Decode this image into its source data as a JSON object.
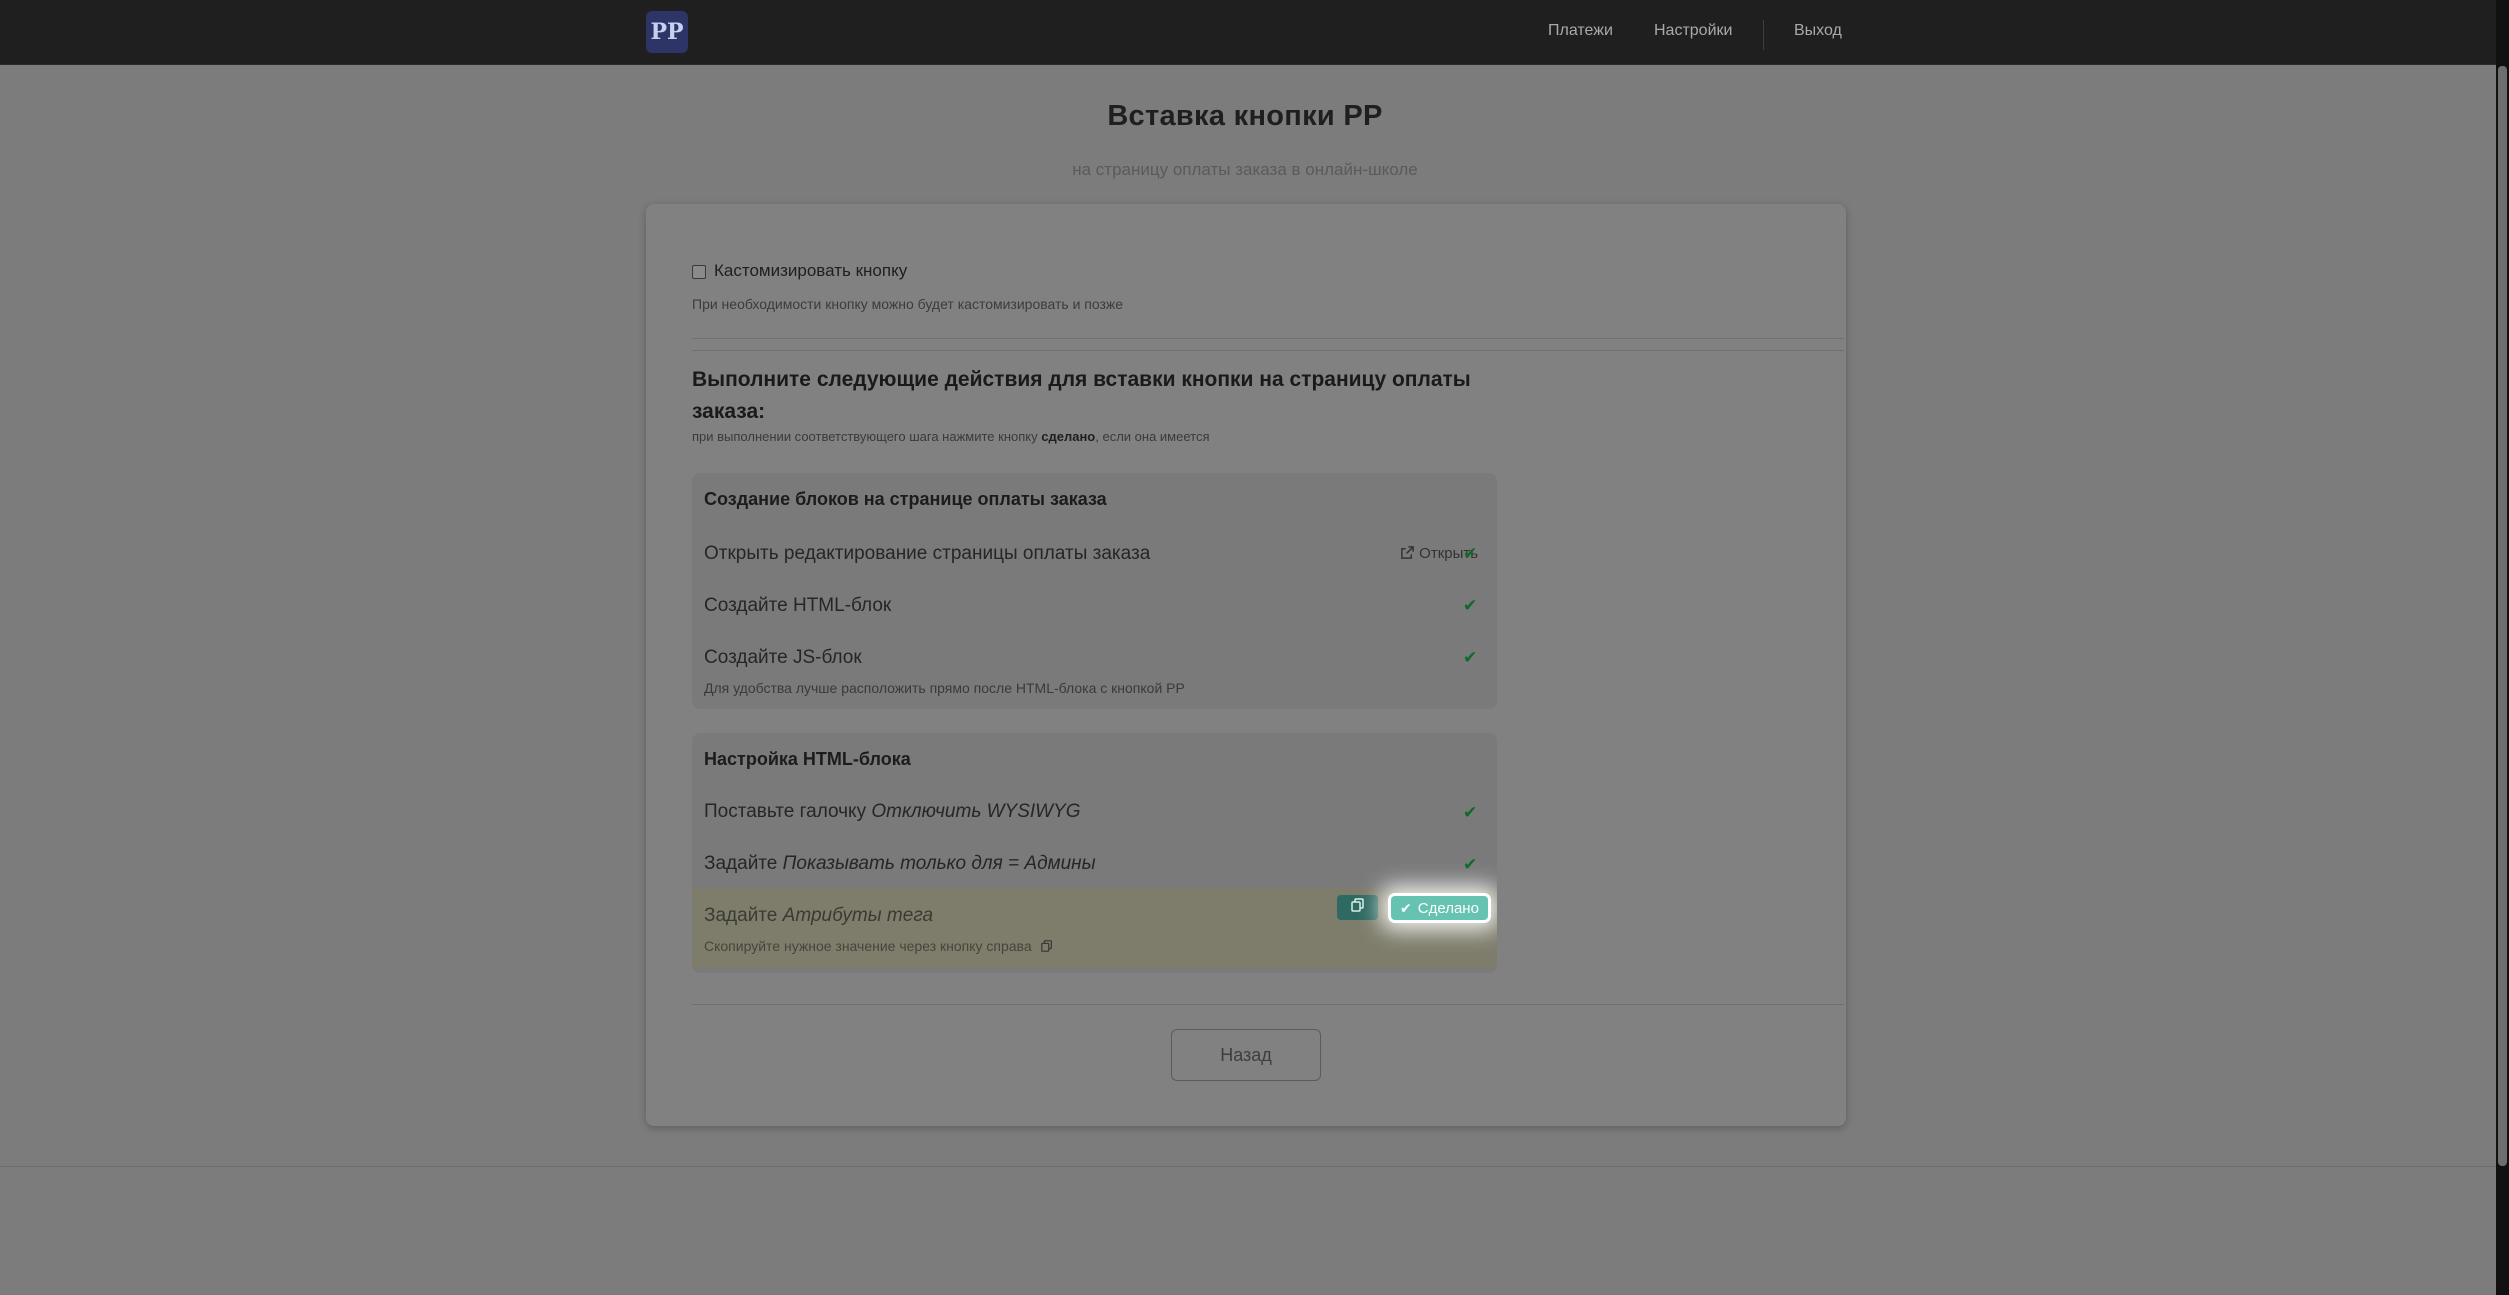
{
  "nav": {
    "logo_text": "PP",
    "links": [
      "Платежи",
      "Настройки",
      "Выход"
    ]
  },
  "page": {
    "title": "Вставка кнопки PP",
    "subtitle": "на страницу оплаты заказа в онлайн-школе"
  },
  "customize": {
    "checkbox_label": "Кастомизировать кнопку",
    "checked": false,
    "hint": "При необходимости кнопку можно будет кастомизировать и позже"
  },
  "instructions": {
    "heading_line1": "Выполните следующие действия для вставки кнопки на страницу оплаты",
    "heading_line2": "заказа:",
    "hint_prefix": "при выполнении соответствующего шага нажмите кнопку",
    "hint_bold": "сделано",
    "hint_suffix": ", если она имеется"
  },
  "blocks": [
    {
      "title": "Создание блоков на странице оплаты заказа",
      "steps": [
        {
          "text": "Открыть редактирование страницы оплаты заказа",
          "link": "Открыть",
          "done": true
        },
        {
          "text": "Создайте HTML-блок",
          "done": true
        },
        {
          "text": "Создайте JS-блок",
          "done": true,
          "note": "Для удобства лучше расположить прямо после HTML-блока с кнопкой PP"
        }
      ]
    },
    {
      "title": "Настройка HTML-блока",
      "steps": [
        {
          "prefix": "Поставьте галочку ",
          "em": "Отключить WYSIWYG",
          "done": true
        },
        {
          "prefix": "Задайте ",
          "em": "Показывать только для = Админы",
          "done": true
        },
        {
          "prefix": "Задайте ",
          "em": "Атрибуты тега",
          "done": false,
          "done_label": "Сделано",
          "note": "Скопируйте нужное значение через кнопку справа"
        }
      ]
    }
  ],
  "back_label": "Назад",
  "colors": {
    "navbar": "#1f1f1f",
    "overlay_bg": "#7c7c7c",
    "done_button": "#66c3b2",
    "check": "#0d6b2a"
  }
}
